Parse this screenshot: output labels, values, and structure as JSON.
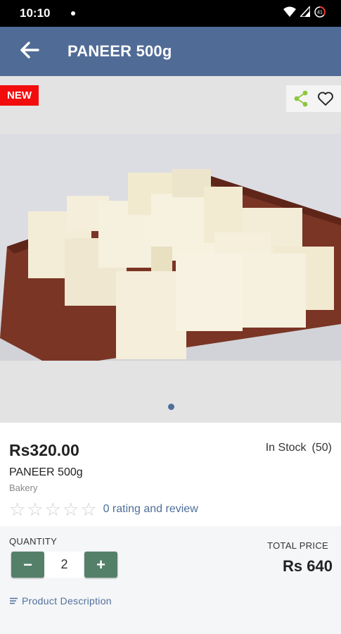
{
  "status_bar": {
    "time": "10:10",
    "battery_level": "41"
  },
  "app_bar": {
    "title": "PANEER 500g"
  },
  "product_image": {
    "badge": "NEW",
    "page_count": 1,
    "current_page": 1
  },
  "product": {
    "price": "Rs320.00",
    "stock_status": "In Stock",
    "stock_count": "(50)",
    "name": "PANEER 500g",
    "category": "Bakery",
    "rating": 0,
    "max_rating": 5,
    "rating_text": "0 rating and review"
  },
  "quantity": {
    "label": "QUANTITY",
    "minus": "−",
    "value": "2",
    "plus": "+"
  },
  "total": {
    "label": "TOTAL PRICE",
    "value": "Rs 640"
  },
  "description": {
    "label": "Product Description"
  },
  "icons": {
    "back": "arrow-left-icon",
    "share": "share-icon",
    "favorite": "heart-outline-icon",
    "star": "star-outline-icon",
    "list": "list-icon"
  },
  "colors": {
    "app_bar": "#506c96",
    "badge": "#f10d0d",
    "accent": "#4f6f9a",
    "stepper": "#54806a",
    "share": "#8dc63f",
    "star": "#cfcfcf"
  }
}
